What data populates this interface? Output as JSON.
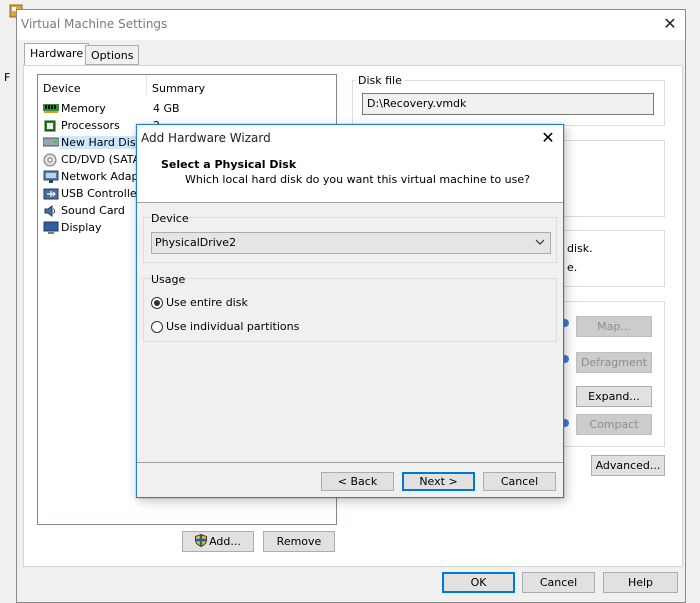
{
  "window": {
    "title": "Virtual Machine Settings",
    "close_glyph": "✕",
    "tabs": [
      {
        "label": "Hardware",
        "active": true
      },
      {
        "label": "Options",
        "active": false
      }
    ]
  },
  "bg": {
    "left_letter": "F"
  },
  "devices": {
    "col_device": "Device",
    "col_summary": "Summary",
    "items": [
      {
        "name": "Memory",
        "summary": "4 GB",
        "icon": "memory-icon"
      },
      {
        "name": "Processors",
        "summary": "2",
        "icon": "processor-icon"
      },
      {
        "name": "New Hard Disk ...",
        "summary": "",
        "icon": "hard-disk-icon",
        "selected": true
      },
      {
        "name": "CD/DVD (SATA)",
        "summary": "",
        "icon": "cd-dvd-icon"
      },
      {
        "name": "Network Adapter",
        "summary": "",
        "icon": "network-adapter-icon"
      },
      {
        "name": "USB Controller",
        "summary": "",
        "icon": "usb-icon"
      },
      {
        "name": "Sound Card",
        "summary": "",
        "icon": "sound-card-icon"
      },
      {
        "name": "Display",
        "summary": "",
        "icon": "display-icon"
      }
    ],
    "add_label": "Add...",
    "remove_label": "Remove"
  },
  "disk_file": {
    "group_label": "Disk file",
    "value": "D:\\Recovery.vmdk"
  },
  "right_panel": {
    "partial_text_1": "disk.",
    "partial_text_2": "e.",
    "map_label": "Map...",
    "defragment_label": "Defragment",
    "expand_label": "Expand...",
    "compact_label": "Compact",
    "advanced_label": "Advanced..."
  },
  "footer": {
    "ok_label": "OK",
    "cancel_label": "Cancel",
    "help_label": "Help"
  },
  "wizard": {
    "title": "Add Hardware Wizard",
    "close_glyph": "✕",
    "heading": "Select a Physical Disk",
    "subheading": "Which local hard disk do you want this virtual machine to use?",
    "device_group_label": "Device",
    "device_selected": "PhysicalDrive2",
    "usage_group_label": "Usage",
    "usage_options": [
      {
        "label": "Use entire disk",
        "selected": true
      },
      {
        "label": "Use individual partitions",
        "selected": false
      }
    ],
    "back_label": "< Back",
    "next_label": "Next >",
    "cancel_label": "Cancel"
  },
  "colors": {
    "accent": "#0078d7",
    "selection": "#cce8ff",
    "window_bg": "#f0f0f0"
  }
}
